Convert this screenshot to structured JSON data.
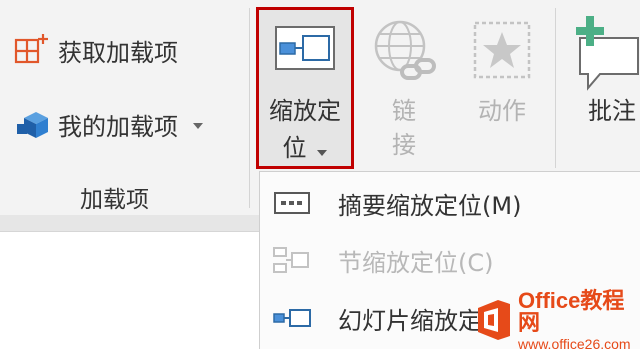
{
  "ribbon": {
    "addins_group": {
      "get_addins_label": "获取加载项",
      "my_addins_label": "我的加载项",
      "group_label": "加载项"
    },
    "zoom_button": {
      "label_line1": "缩放定",
      "label_line2": "位"
    },
    "link_button": {
      "label_line1": "链",
      "label_line2": "接"
    },
    "action_button": {
      "label": "动作"
    },
    "comment_button": {
      "label": "批注"
    }
  },
  "zoom_menu": {
    "items": [
      {
        "label": "摘要缩放定位(M)",
        "enabled": true
      },
      {
        "label": "节缩放定位(C)",
        "enabled": false
      },
      {
        "label": "幻灯片缩放定位",
        "enabled": true
      }
    ]
  },
  "watermark": {
    "brand": "Office教程网",
    "url": "www.office26.com"
  }
}
